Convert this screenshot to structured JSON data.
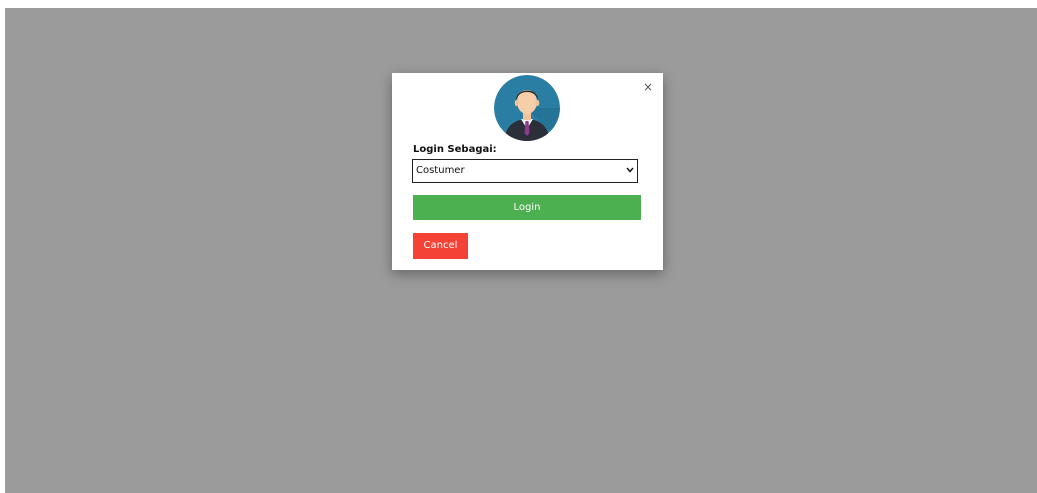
{
  "modal": {
    "close_label": "×",
    "avatar_icon": "user-avatar-icon",
    "label": "Login Sebagai:",
    "select": {
      "selected": "Costumer",
      "icon": "chevron-down-icon"
    },
    "login_label": "Login",
    "cancel_label": "Cancel"
  },
  "colors": {
    "backdrop": "#9b9b9b",
    "login": "#4caf50",
    "cancel": "#f44336",
    "avatar_bg": "#2a7ea4"
  }
}
